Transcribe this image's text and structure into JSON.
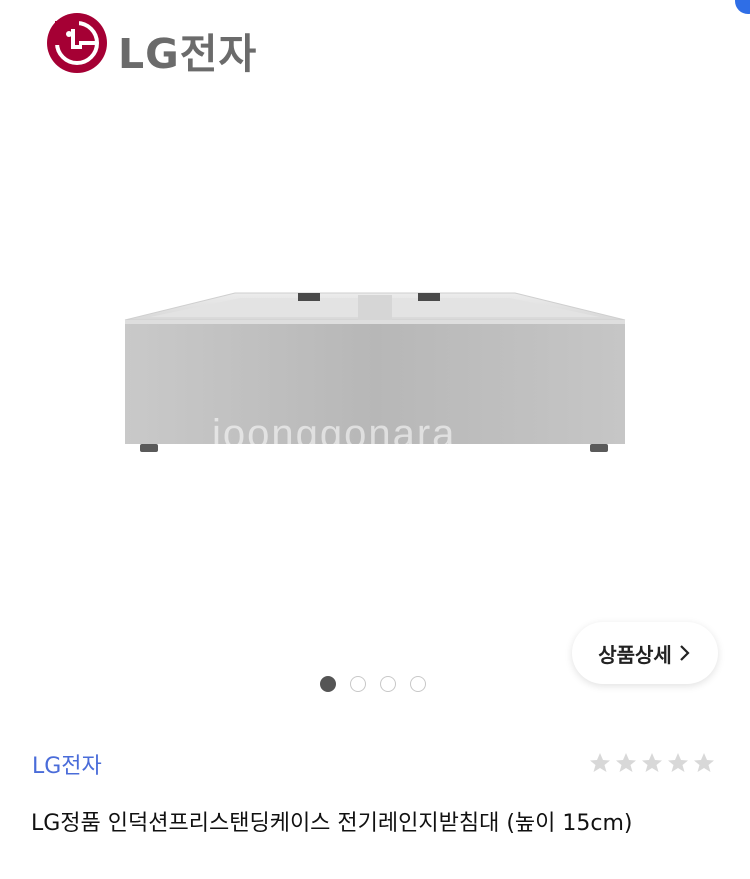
{
  "header": {
    "logo_text": "LG전자",
    "icons": [
      "back-arrow-icon",
      "lg-logo-icon",
      "search-icon",
      "home-icon",
      "cart-icon"
    ]
  },
  "gallery": {
    "image_subject": "stainless steel stand case",
    "watermark": "joonggonara",
    "detail_button_label": "상품상세",
    "slide_count": 4,
    "active_slide": 1
  },
  "product": {
    "brand": "LG전자",
    "rating_stars": 0,
    "rating_max": 5,
    "title": "LG정품 인덕션프리스탠딩케이스 전기레인지받침대 (높이 15cm)"
  },
  "colors": {
    "brand_link": "#4a6cd9",
    "lg_red": "#a50034",
    "badge_blue": "#2f6ee6",
    "star_gray": "#d8d8d8"
  }
}
